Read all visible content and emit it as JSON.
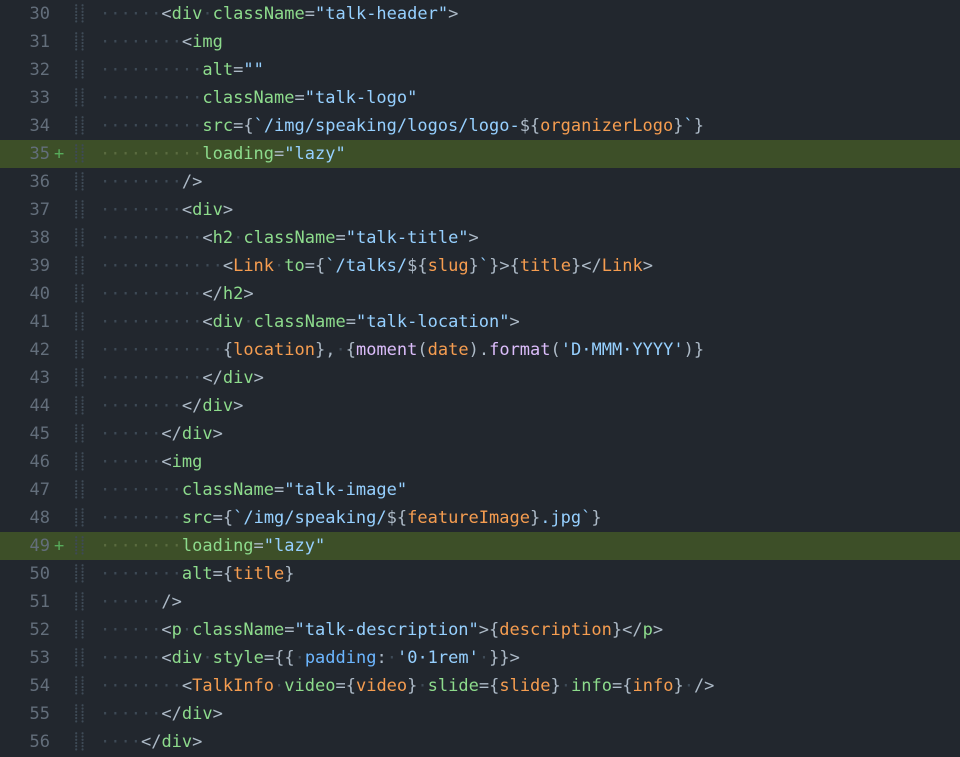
{
  "gutter_start": 30,
  "lines": [
    {
      "n": 30,
      "diff": "",
      "indent": 6,
      "added": false,
      "tokens": [
        [
          "punc",
          "<"
        ],
        [
          "tag",
          "div"
        ],
        [
          "ws",
          " "
        ],
        [
          "tag",
          "className"
        ],
        [
          "punc",
          "="
        ],
        [
          "str",
          "\"talk-header\""
        ],
        [
          "punc",
          ">"
        ]
      ]
    },
    {
      "n": 31,
      "diff": "",
      "indent": 8,
      "added": false,
      "tokens": [
        [
          "punc",
          "<"
        ],
        [
          "tag",
          "img"
        ]
      ]
    },
    {
      "n": 32,
      "diff": "",
      "indent": 10,
      "added": false,
      "tokens": [
        [
          "tag",
          "alt"
        ],
        [
          "punc",
          "="
        ],
        [
          "str",
          "\"\""
        ]
      ]
    },
    {
      "n": 33,
      "diff": "",
      "indent": 10,
      "added": false,
      "tokens": [
        [
          "tag",
          "className"
        ],
        [
          "punc",
          "="
        ],
        [
          "str",
          "\"talk-logo\""
        ]
      ]
    },
    {
      "n": 34,
      "diff": "",
      "indent": 10,
      "added": false,
      "tokens": [
        [
          "tag",
          "src"
        ],
        [
          "punc",
          "="
        ],
        [
          "punc",
          "{"
        ],
        [
          "str",
          "`/img/speaking/logos/logo-"
        ],
        [
          "punc",
          "${"
        ],
        [
          "var",
          "organizerLogo"
        ],
        [
          "punc",
          "}"
        ],
        [
          "str",
          "`"
        ],
        [
          "punc",
          "}"
        ]
      ]
    },
    {
      "n": 35,
      "diff": "+",
      "indent": 10,
      "added": true,
      "tokens": [
        [
          "tag",
          "loading"
        ],
        [
          "punc",
          "="
        ],
        [
          "str",
          "\"lazy\""
        ]
      ]
    },
    {
      "n": 36,
      "diff": "",
      "indent": 8,
      "added": false,
      "tokens": [
        [
          "punc",
          "/>"
        ]
      ]
    },
    {
      "n": 37,
      "diff": "",
      "indent": 8,
      "added": false,
      "tokens": [
        [
          "punc",
          "<"
        ],
        [
          "tag",
          "div"
        ],
        [
          "punc",
          ">"
        ]
      ]
    },
    {
      "n": 38,
      "diff": "",
      "indent": 10,
      "added": false,
      "tokens": [
        [
          "punc",
          "<"
        ],
        [
          "tag",
          "h2"
        ],
        [
          "ws",
          " "
        ],
        [
          "tag",
          "className"
        ],
        [
          "punc",
          "="
        ],
        [
          "str",
          "\"talk-title\""
        ],
        [
          "punc",
          ">"
        ]
      ]
    },
    {
      "n": 39,
      "diff": "",
      "indent": 12,
      "added": false,
      "tokens": [
        [
          "punc",
          "<"
        ],
        [
          "comp",
          "Link"
        ],
        [
          "ws",
          " "
        ],
        [
          "tag",
          "to"
        ],
        [
          "punc",
          "="
        ],
        [
          "punc",
          "{"
        ],
        [
          "str",
          "`/talks/"
        ],
        [
          "punc",
          "${"
        ],
        [
          "var",
          "slug"
        ],
        [
          "punc",
          "}"
        ],
        [
          "str",
          "`"
        ],
        [
          "punc",
          "}"
        ],
        [
          "punc",
          ">"
        ],
        [
          "punc",
          "{"
        ],
        [
          "var",
          "title"
        ],
        [
          "punc",
          "}"
        ],
        [
          "punc",
          "</"
        ],
        [
          "comp",
          "Link"
        ],
        [
          "punc",
          ">"
        ]
      ]
    },
    {
      "n": 40,
      "diff": "",
      "indent": 10,
      "added": false,
      "tokens": [
        [
          "punc",
          "</"
        ],
        [
          "tag",
          "h2"
        ],
        [
          "punc",
          ">"
        ]
      ]
    },
    {
      "n": 41,
      "diff": "",
      "indent": 10,
      "added": false,
      "tokens": [
        [
          "punc",
          "<"
        ],
        [
          "tag",
          "div"
        ],
        [
          "ws",
          " "
        ],
        [
          "tag",
          "className"
        ],
        [
          "punc",
          "="
        ],
        [
          "str",
          "\"talk-location\""
        ],
        [
          "punc",
          ">"
        ]
      ]
    },
    {
      "n": 42,
      "diff": "",
      "indent": 12,
      "added": false,
      "tokens": [
        [
          "punc",
          "{"
        ],
        [
          "var",
          "location"
        ],
        [
          "punc",
          "}"
        ],
        [
          "punc",
          ","
        ],
        [
          "ws",
          " "
        ],
        [
          "punc",
          "{"
        ],
        [
          "method",
          "moment"
        ],
        [
          "punc",
          "("
        ],
        [
          "var",
          "date"
        ],
        [
          "punc",
          ")"
        ],
        [
          "punc",
          "."
        ],
        [
          "method",
          "format"
        ],
        [
          "punc",
          "("
        ],
        [
          "str",
          "'D MMM YYYY'"
        ],
        [
          "punc",
          ")"
        ],
        [
          "punc",
          "}"
        ]
      ]
    },
    {
      "n": 43,
      "diff": "",
      "indent": 10,
      "added": false,
      "tokens": [
        [
          "punc",
          "</"
        ],
        [
          "tag",
          "div"
        ],
        [
          "punc",
          ">"
        ]
      ]
    },
    {
      "n": 44,
      "diff": "",
      "indent": 8,
      "added": false,
      "tokens": [
        [
          "punc",
          "</"
        ],
        [
          "tag",
          "div"
        ],
        [
          "punc",
          ">"
        ]
      ]
    },
    {
      "n": 45,
      "diff": "",
      "indent": 6,
      "added": false,
      "tokens": [
        [
          "punc",
          "</"
        ],
        [
          "tag",
          "div"
        ],
        [
          "punc",
          ">"
        ]
      ]
    },
    {
      "n": 46,
      "diff": "",
      "indent": 6,
      "added": false,
      "tokens": [
        [
          "punc",
          "<"
        ],
        [
          "tag",
          "img"
        ]
      ]
    },
    {
      "n": 47,
      "diff": "",
      "indent": 8,
      "added": false,
      "tokens": [
        [
          "tag",
          "className"
        ],
        [
          "punc",
          "="
        ],
        [
          "str",
          "\"talk-image\""
        ]
      ]
    },
    {
      "n": 48,
      "diff": "",
      "indent": 8,
      "added": false,
      "tokens": [
        [
          "tag",
          "src"
        ],
        [
          "punc",
          "="
        ],
        [
          "punc",
          "{"
        ],
        [
          "str",
          "`/img/speaking/"
        ],
        [
          "punc",
          "${"
        ],
        [
          "var",
          "featureImage"
        ],
        [
          "punc",
          "}"
        ],
        [
          "str",
          ".jpg`"
        ],
        [
          "punc",
          "}"
        ]
      ]
    },
    {
      "n": 49,
      "diff": "+",
      "indent": 8,
      "added": true,
      "tokens": [
        [
          "tag",
          "loading"
        ],
        [
          "punc",
          "="
        ],
        [
          "str",
          "\"lazy\""
        ]
      ]
    },
    {
      "n": 50,
      "diff": "",
      "indent": 8,
      "added": false,
      "tokens": [
        [
          "tag",
          "alt"
        ],
        [
          "punc",
          "="
        ],
        [
          "punc",
          "{"
        ],
        [
          "var",
          "title"
        ],
        [
          "punc",
          "}"
        ]
      ]
    },
    {
      "n": 51,
      "diff": "",
      "indent": 6,
      "added": false,
      "tokens": [
        [
          "punc",
          "/>"
        ]
      ]
    },
    {
      "n": 52,
      "diff": "",
      "indent": 6,
      "added": false,
      "tokens": [
        [
          "punc",
          "<"
        ],
        [
          "tag",
          "p"
        ],
        [
          "ws",
          " "
        ],
        [
          "tag",
          "className"
        ],
        [
          "punc",
          "="
        ],
        [
          "str",
          "\"talk-description\""
        ],
        [
          "punc",
          ">"
        ],
        [
          "punc",
          "{"
        ],
        [
          "var",
          "description"
        ],
        [
          "punc",
          "}"
        ],
        [
          "punc",
          "</"
        ],
        [
          "tag",
          "p"
        ],
        [
          "punc",
          ">"
        ]
      ]
    },
    {
      "n": 53,
      "diff": "",
      "indent": 6,
      "added": false,
      "tokens": [
        [
          "punc",
          "<"
        ],
        [
          "tag",
          "div"
        ],
        [
          "ws",
          " "
        ],
        [
          "tag",
          "style"
        ],
        [
          "punc",
          "="
        ],
        [
          "punc",
          "{{"
        ],
        [
          "ws",
          " "
        ],
        [
          "key",
          "padding"
        ],
        [
          "punc",
          ":"
        ],
        [
          "ws",
          " "
        ],
        [
          "str",
          "'0 1rem'"
        ],
        [
          "ws",
          " "
        ],
        [
          "punc",
          "}}"
        ],
        [
          "punc",
          ">"
        ]
      ]
    },
    {
      "n": 54,
      "diff": "",
      "indent": 8,
      "added": false,
      "tokens": [
        [
          "punc",
          "<"
        ],
        [
          "comp",
          "TalkInfo"
        ],
        [
          "ws",
          " "
        ],
        [
          "tag",
          "video"
        ],
        [
          "punc",
          "="
        ],
        [
          "punc",
          "{"
        ],
        [
          "var",
          "video"
        ],
        [
          "punc",
          "}"
        ],
        [
          "ws",
          " "
        ],
        [
          "tag",
          "slide"
        ],
        [
          "punc",
          "="
        ],
        [
          "punc",
          "{"
        ],
        [
          "var",
          "slide"
        ],
        [
          "punc",
          "}"
        ],
        [
          "ws",
          " "
        ],
        [
          "tag",
          "info"
        ],
        [
          "punc",
          "="
        ],
        [
          "punc",
          "{"
        ],
        [
          "var",
          "info"
        ],
        [
          "punc",
          "}"
        ],
        [
          "ws",
          " "
        ],
        [
          "punc",
          "/>"
        ]
      ]
    },
    {
      "n": 55,
      "diff": "",
      "indent": 6,
      "added": false,
      "tokens": [
        [
          "punc",
          "</"
        ],
        [
          "tag",
          "div"
        ],
        [
          "punc",
          ">"
        ]
      ]
    },
    {
      "n": 56,
      "diff": "",
      "indent": 4,
      "added": false,
      "tokens": [
        [
          "punc",
          "</"
        ],
        [
          "tag",
          "div"
        ],
        [
          "punc",
          ">"
        ]
      ]
    }
  ]
}
